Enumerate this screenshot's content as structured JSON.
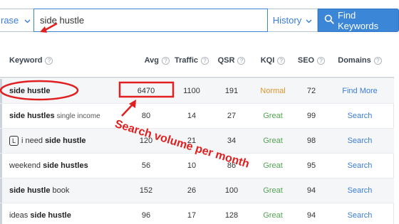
{
  "search": {
    "mode_label": "rase",
    "value": "side hustle",
    "history_label": "History",
    "find_label": "Find Keywords"
  },
  "table": {
    "headers": {
      "keyword": "Keyword",
      "avg": "Avg",
      "traffic": "Traffic",
      "qsr": "QSR",
      "kqi": "KQI",
      "seo": "SEO",
      "domains": "Domains"
    },
    "rows": [
      {
        "kw_pre": "",
        "kw_bold": "side hustle",
        "kw_post": "",
        "avg": "6470",
        "traffic": "1100",
        "qsr": "191",
        "kqi": "Normal",
        "seo": "72",
        "domains": "Find More"
      },
      {
        "kw_pre": "",
        "kw_bold": "side hustles",
        "kw_post": "single income",
        "avg": "80",
        "traffic": "14",
        "qsr": "27",
        "kqi": "Great",
        "seo": "99",
        "domains": "Search"
      },
      {
        "kw_pre": "i need",
        "kw_bold": "side hustle",
        "kw_post": "",
        "tag": "L",
        "avg": "120",
        "traffic": "21",
        "qsr": "34",
        "kqi": "Great",
        "seo": "98",
        "domains": "Search"
      },
      {
        "kw_pre": "weekend",
        "kw_bold": "side hustles",
        "kw_post": "",
        "avg": "56",
        "traffic": "10",
        "qsr": "86",
        "kqi": "Great",
        "seo": "95",
        "domains": "Search"
      },
      {
        "kw_pre": "",
        "kw_bold": "side hustle",
        "kw_post": "book",
        "avg": "152",
        "traffic": "26",
        "qsr": "100",
        "kqi": "Great",
        "seo": "94",
        "domains": "Search"
      },
      {
        "kw_pre": "ideas",
        "kw_bold": "side hustle",
        "kw_post": "",
        "avg": "96",
        "traffic": "17",
        "qsr": "128",
        "kqi": "Great",
        "seo": "94",
        "domains": "Search"
      }
    ]
  },
  "annotation": {
    "text": "Search volume per month",
    "color": "#e02020"
  },
  "colors": {
    "accent": "#3b86d6",
    "great": "#52a352",
    "normal": "#e0952b"
  }
}
